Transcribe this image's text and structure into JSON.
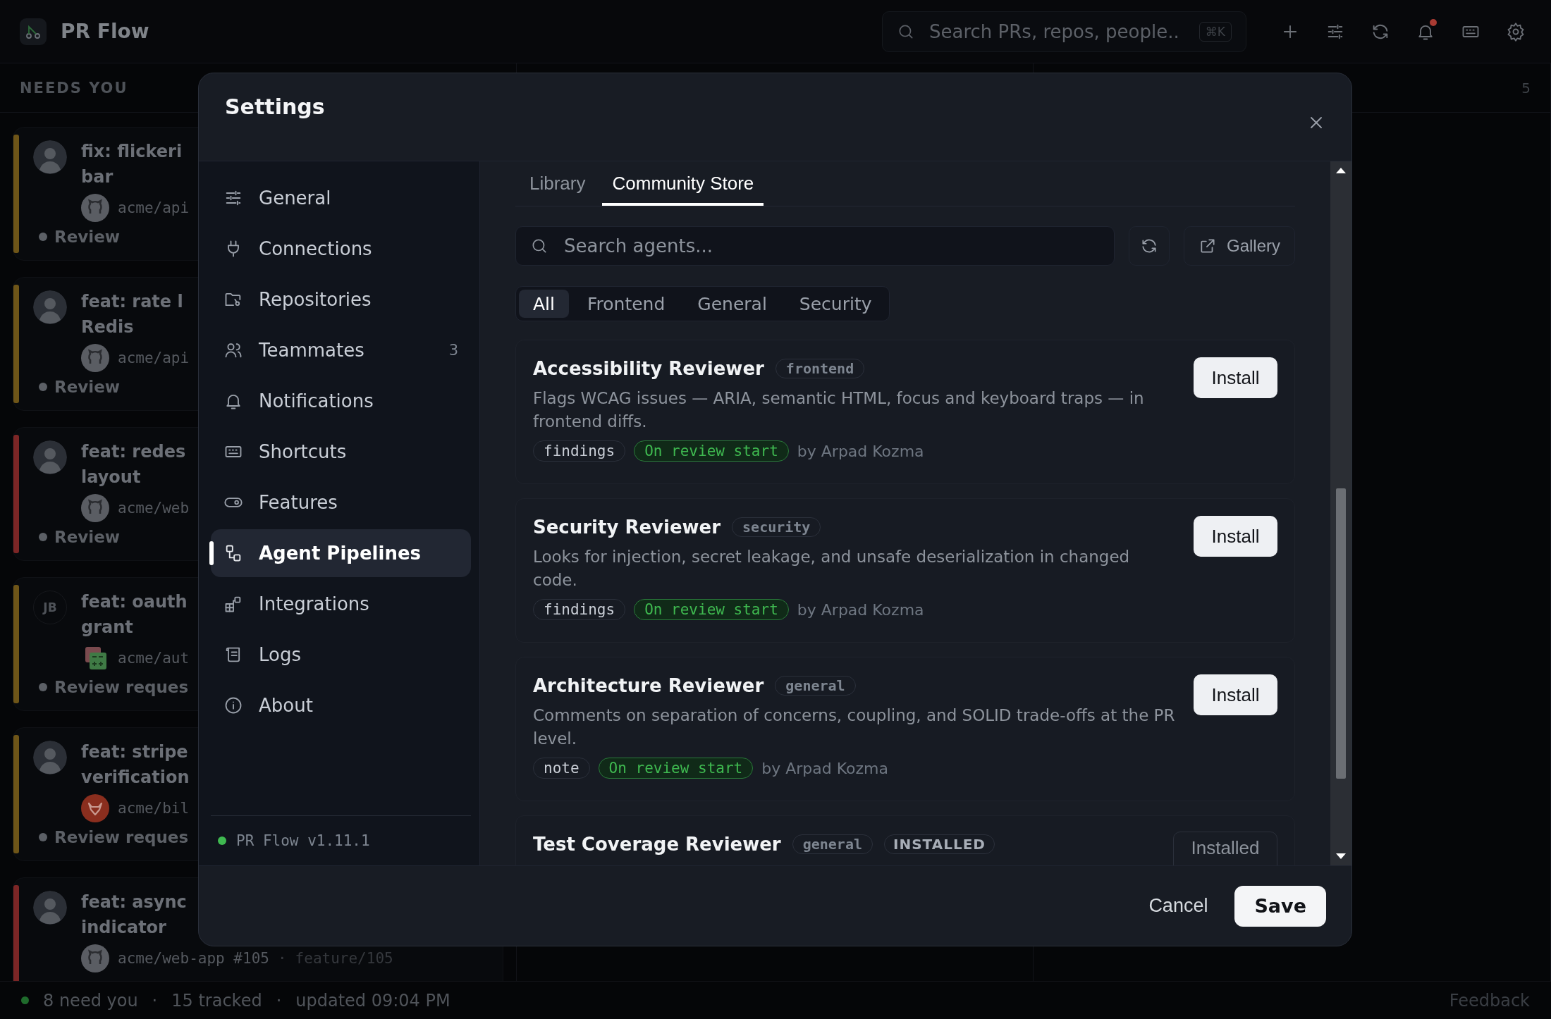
{
  "app": {
    "name": "PR Flow",
    "search_placeholder": "Search PRs, repos, people..",
    "shortcut": "⌘K",
    "notifications_unread": true
  },
  "needs_you": {
    "title": "NEEDS YOU",
    "cards": [
      {
        "color": "#6e5518",
        "title_lines": [
          "fix: flickeri",
          "bar"
        ],
        "repo": "acme/api",
        "status": "Review"
      },
      {
        "color": "#6e5518",
        "title_lines": [
          "feat: rate l",
          "Redis"
        ],
        "repo": "acme/api",
        "status": "Review"
      },
      {
        "color": "#7c2626",
        "title_lines": [
          "feat: redes",
          "layout"
        ],
        "repo": "acme/web",
        "status": "Review"
      },
      {
        "color": "#6e5518",
        "avatar_initials": "JB",
        "title_lines": [
          "feat: oauth",
          "grant"
        ],
        "repo": "acme/aut",
        "status": "Review reques"
      },
      {
        "color": "#6e5518",
        "title_lines": [
          "feat: stripe",
          "verification"
        ],
        "repo": "acme/bil",
        "status": "Review reques"
      },
      {
        "color": "#7c2626",
        "title_lines": [
          "feat: async",
          "indicator"
        ],
        "repo": "acme/web-app #105",
        "separator": "·",
        "branch": "feature/105"
      }
    ]
  },
  "column_3": {
    "count": "5"
  },
  "settings": {
    "title": "Settings",
    "sidebar": [
      {
        "label": "General",
        "selected": false
      },
      {
        "label": "Connections",
        "selected": false
      },
      {
        "label": "Repositories",
        "selected": false
      },
      {
        "label": "Teammates",
        "count": "3",
        "selected": false
      },
      {
        "label": "Notifications",
        "selected": false
      },
      {
        "label": "Shortcuts",
        "selected": false
      },
      {
        "label": "Features",
        "selected": false
      },
      {
        "label": "Agent Pipelines",
        "selected": true
      },
      {
        "label": "Integrations",
        "selected": false
      },
      {
        "label": "Logs",
        "selected": false
      },
      {
        "label": "About",
        "selected": false
      }
    ],
    "version": "PR Flow v1.11.1",
    "tabs": [
      {
        "label": "Library",
        "selected": false
      },
      {
        "label": "Community Store",
        "selected": true
      }
    ],
    "search_placeholder": "Search agents...",
    "gallery": "Gallery",
    "filters": [
      {
        "label": "All",
        "selected": true
      },
      {
        "label": "Frontend",
        "selected": false
      },
      {
        "label": "General",
        "selected": false
      },
      {
        "label": "Security",
        "selected": false
      }
    ],
    "agents": [
      {
        "name": "Accessibility Reviewer",
        "category": "frontend",
        "installed": false,
        "action": "Install",
        "description": "Flags WCAG issues — ARIA, semantic HTML, focus and keyboard traps — in frontend diffs.",
        "output": "findings",
        "trigger": "On review start",
        "author": "by Arpad Kozma"
      },
      {
        "name": "Security Reviewer",
        "category": "security",
        "installed": false,
        "action": "Install",
        "description": "Looks for injection, secret leakage, and unsafe deserialization in changed code.",
        "output": "findings",
        "trigger": "On review start",
        "author": "by Arpad Kozma"
      },
      {
        "name": "Architecture Reviewer",
        "category": "general",
        "installed": false,
        "action": "Install",
        "description": "Comments on separation of concerns, coupling, and SOLID trade-offs at the PR level.",
        "output": "note",
        "trigger": "On review start",
        "author": "by Arpad Kozma"
      },
      {
        "name": "Test Coverage Reviewer",
        "category": "general",
        "installed": true,
        "badge": "INSTALLED",
        "action": "Installed"
      }
    ],
    "cancel": "Cancel",
    "save": "Save"
  },
  "status_bar": {
    "need_you": "8 need you",
    "separator_1": "·",
    "tracked": "15 tracked",
    "separator_2": "·",
    "updated": "updated 09:04 PM",
    "feedback": "Feedback"
  }
}
